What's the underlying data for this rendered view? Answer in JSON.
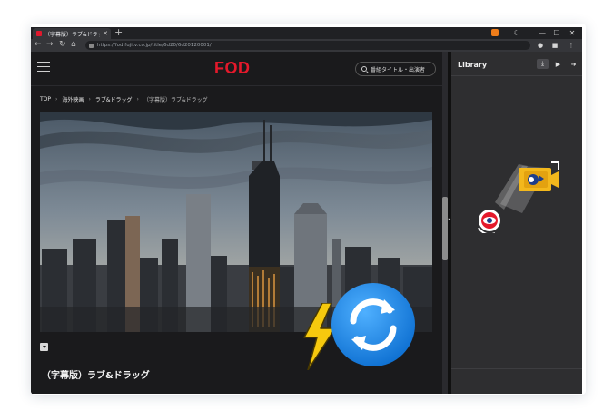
{
  "browser": {
    "tab_title": "（字幕版）ラブ&ドラッグ",
    "tab_close": "✕",
    "new_tab": "+",
    "url": "https://fod.fujitv.co.jp/title/6d20/6d20120001/",
    "back": "←",
    "forward": "→",
    "reload": "↻",
    "home": "⌂",
    "minimize": "—",
    "maximize": "☐",
    "close": "✕"
  },
  "site": {
    "logo": "FOD",
    "search_placeholder": "番組タイトル・出演者",
    "breadcrumb": [
      "TOP",
      "海外映画",
      "ラブ&ドラッグ",
      "（字幕版）ラブ&ドラッグ"
    ],
    "breadcrumb_sep": "›",
    "title": "（字幕版）ラブ&ドラッグ"
  },
  "library": {
    "title": "Library",
    "download_btn": "⤓",
    "video_btn": "▶",
    "export_btn": "➜"
  },
  "colors": {
    "brand_red": "#e4192b",
    "sync_blue": "#1a8ae6",
    "bolt_yellow": "#f6c90e",
    "camera_yellow": "#f3b81c"
  }
}
